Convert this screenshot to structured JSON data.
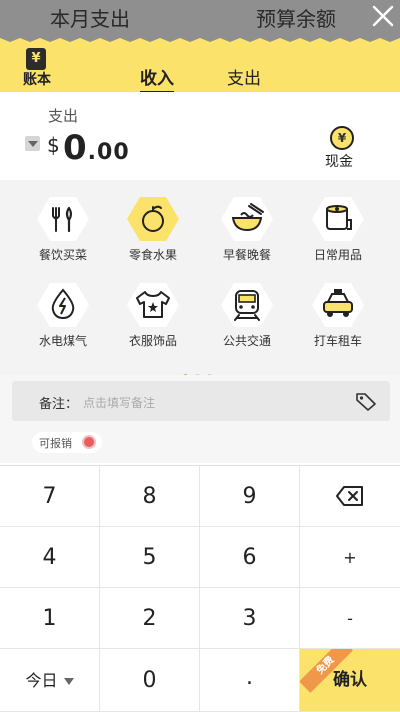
{
  "top_bar": {
    "left_title": "本月支出",
    "right_title": "预算余额",
    "close_icon": "close-icon"
  },
  "header": {
    "book_icon": "¥",
    "book_label": "账本",
    "tabs": [
      {
        "label": "收入",
        "active": true
      },
      {
        "label": "支出",
        "active": false
      }
    ]
  },
  "entry": {
    "type_label": "支出",
    "currency": "$",
    "amount_int": "0",
    "amount_dec": ".00",
    "account_icon": "¥",
    "account_label": "现金"
  },
  "categories": [
    {
      "label": "餐饮买菜",
      "icon": "utensils-icon",
      "selected": false
    },
    {
      "label": "零食水果",
      "icon": "apple-icon",
      "selected": true
    },
    {
      "label": "早餐晚餐",
      "icon": "noodle-bowl-icon",
      "selected": false
    },
    {
      "label": "日常用品",
      "icon": "toilet-paper-icon",
      "selected": false
    },
    {
      "label": "水电煤气",
      "icon": "utility-drop-icon",
      "selected": false
    },
    {
      "label": "衣服饰品",
      "icon": "shirt-icon",
      "selected": false
    },
    {
      "label": "公共交通",
      "icon": "train-icon",
      "selected": false
    },
    {
      "label": "打车租车",
      "icon": "taxi-icon",
      "selected": false
    }
  ],
  "page_dots": {
    "count": 3,
    "active_index": 0
  },
  "note": {
    "label": "备注：",
    "placeholder": "点击填写备注"
  },
  "reimbursable": {
    "label": "可报销"
  },
  "keypad": {
    "rows": [
      [
        "7",
        "8",
        "9",
        "⌫"
      ],
      [
        "4",
        "5",
        "6",
        "+"
      ],
      [
        "1",
        "2",
        "3",
        "-"
      ],
      [
        "今日",
        "0",
        ".",
        "确认"
      ]
    ],
    "confirm_ribbon": "免费",
    "colors": {
      "accent": "#fbe26b",
      "ribbon": "#f0984a"
    }
  }
}
